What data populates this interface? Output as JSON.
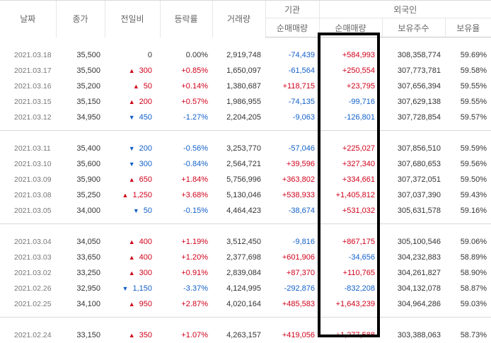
{
  "headers": {
    "date": "날짜",
    "close": "종가",
    "change": "전일비",
    "rate": "등락률",
    "volume": "거래량",
    "institution": "기관",
    "foreign": "외국인",
    "inst_net": "순매매량",
    "foreign_net": "순매매량",
    "foreign_holdings": "보유주수",
    "foreign_ratio": "보유율"
  },
  "groups": [
    [
      {
        "date": "2021.03.18",
        "close": "35,500",
        "arrow": "",
        "change": "0",
        "rate": "0.00%",
        "dir": "flat",
        "volume": "2,919,748",
        "inst": "-74,439",
        "foreign": "+584,993",
        "holdings": "308,358,774",
        "ratio": "59.69%"
      },
      {
        "date": "2021.03.17",
        "close": "35,500",
        "arrow": "▲",
        "change": "300",
        "rate": "+0.85%",
        "dir": "up",
        "volume": "1,650,097",
        "inst": "-61,564",
        "foreign": "+250,554",
        "holdings": "307,773,781",
        "ratio": "59.58%"
      },
      {
        "date": "2021.03.16",
        "close": "35,200",
        "arrow": "▲",
        "change": "50",
        "rate": "+0.14%",
        "dir": "up",
        "volume": "1,380,687",
        "inst": "+118,715",
        "foreign": "+23,795",
        "holdings": "307,656,394",
        "ratio": "59.55%"
      },
      {
        "date": "2021.03.15",
        "close": "35,150",
        "arrow": "▲",
        "change": "200",
        "rate": "+0.57%",
        "dir": "up",
        "volume": "1,986,955",
        "inst": "-74,135",
        "foreign": "-99,716",
        "holdings": "307,629,138",
        "ratio": "59.55%"
      },
      {
        "date": "2021.03.12",
        "close": "34,950",
        "arrow": "▼",
        "change": "450",
        "rate": "-1.27%",
        "dir": "down",
        "volume": "2,204,205",
        "inst": "-9,063",
        "foreign": "-126,801",
        "holdings": "307,728,854",
        "ratio": "59.57%"
      }
    ],
    [
      {
        "date": "2021.03.11",
        "close": "35,400",
        "arrow": "▼",
        "change": "200",
        "rate": "-0.56%",
        "dir": "down",
        "volume": "3,253,770",
        "inst": "-57,046",
        "foreign": "+225,027",
        "holdings": "307,856,510",
        "ratio": "59.59%"
      },
      {
        "date": "2021.03.10",
        "close": "35,600",
        "arrow": "▼",
        "change": "300",
        "rate": "-0.84%",
        "dir": "down",
        "volume": "2,564,721",
        "inst": "+39,596",
        "foreign": "+327,340",
        "holdings": "307,680,653",
        "ratio": "59.56%"
      },
      {
        "date": "2021.03.09",
        "close": "35,900",
        "arrow": "▲",
        "change": "650",
        "rate": "+1.84%",
        "dir": "up",
        "volume": "5,756,996",
        "inst": "+363,802",
        "foreign": "+334,661",
        "holdings": "307,372,051",
        "ratio": "59.50%"
      },
      {
        "date": "2021.03.08",
        "close": "35,250",
        "arrow": "▲",
        "change": "1,250",
        "rate": "+3.68%",
        "dir": "up",
        "volume": "5,130,046",
        "inst": "+538,933",
        "foreign": "+1,405,812",
        "holdings": "307,037,390",
        "ratio": "59.43%"
      },
      {
        "date": "2021.03.05",
        "close": "34,000",
        "arrow": "▼",
        "change": "50",
        "rate": "-0.15%",
        "dir": "down",
        "volume": "4,464,423",
        "inst": "-38,674",
        "foreign": "+531,032",
        "holdings": "305,631,578",
        "ratio": "59.16%"
      }
    ],
    [
      {
        "date": "2021.03.04",
        "close": "34,050",
        "arrow": "▲",
        "change": "400",
        "rate": "+1.19%",
        "dir": "up",
        "volume": "3,512,450",
        "inst": "-9,816",
        "foreign": "+867,175",
        "holdings": "305,100,546",
        "ratio": "59.06%"
      },
      {
        "date": "2021.03.03",
        "close": "33,650",
        "arrow": "▲",
        "change": "400",
        "rate": "+1.20%",
        "dir": "up",
        "volume": "2,377,698",
        "inst": "+601,906",
        "foreign": "-34,656",
        "holdings": "304,232,883",
        "ratio": "58.89%"
      },
      {
        "date": "2021.03.02",
        "close": "33,250",
        "arrow": "▲",
        "change": "300",
        "rate": "+0.91%",
        "dir": "up",
        "volume": "2,839,084",
        "inst": "+87,370",
        "foreign": "+110,765",
        "holdings": "304,261,827",
        "ratio": "58.90%"
      },
      {
        "date": "2021.02.26",
        "close": "32,950",
        "arrow": "▼",
        "change": "1,150",
        "rate": "-3.37%",
        "dir": "down",
        "volume": "4,124,995",
        "inst": "-292,876",
        "foreign": "-832,208",
        "holdings": "304,132,078",
        "ratio": "58.87%"
      },
      {
        "date": "2021.02.25",
        "close": "34,100",
        "arrow": "▲",
        "change": "950",
        "rate": "+2.87%",
        "dir": "up",
        "volume": "4,020,164",
        "inst": "+485,583",
        "foreign": "+1,643,239",
        "holdings": "304,964,286",
        "ratio": "59.03%"
      }
    ],
    [
      {
        "date": "2021.02.24",
        "close": "33,150",
        "arrow": "▲",
        "change": "350",
        "rate": "+1.07%",
        "dir": "up",
        "volume": "4,263,157",
        "inst": "+419,056",
        "foreign": "+1,277,588",
        "holdings": "303,388,063",
        "ratio": "58.73%"
      }
    ]
  ]
}
